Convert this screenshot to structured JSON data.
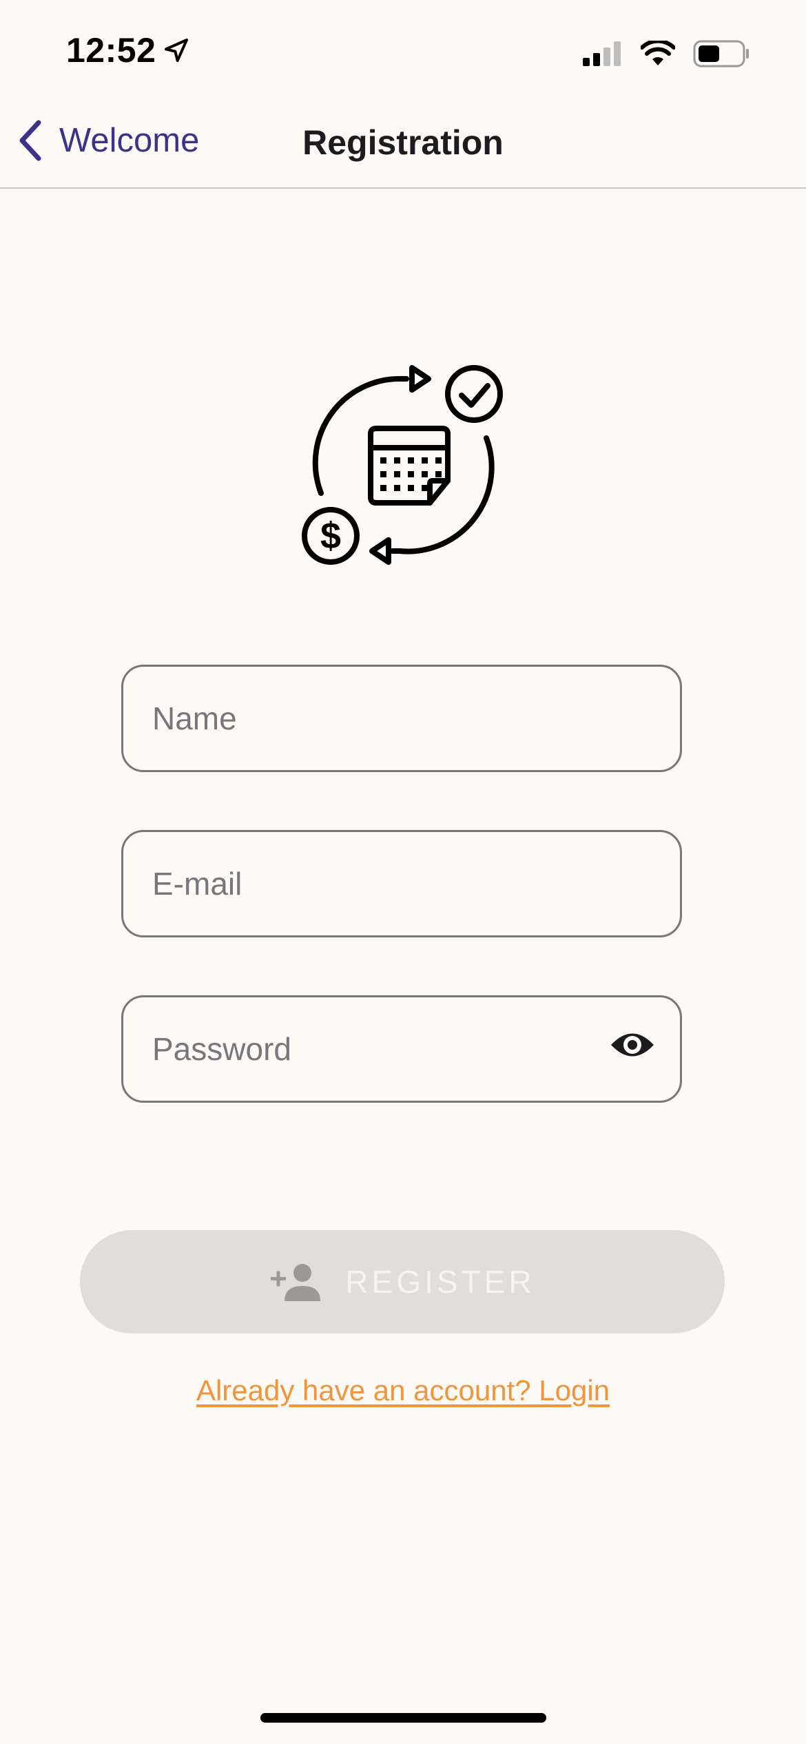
{
  "status_bar": {
    "time": "12:52",
    "location_icon": "location-arrow-icon",
    "signal_icon": "cellular-signal-icon",
    "wifi_icon": "wifi-icon",
    "battery_icon": "battery-icon"
  },
  "nav": {
    "back_label": "Welcome",
    "title": "Registration",
    "back_icon": "chevron-left-icon"
  },
  "hero": {
    "icon": "recurring-payment-calendar-icon"
  },
  "form": {
    "name_placeholder": "Name",
    "email_placeholder": "E-mail",
    "password_placeholder": "Password",
    "password_toggle_icon": "eye-icon"
  },
  "register_button": {
    "label": "REGISTER",
    "icon": "add-person-icon"
  },
  "login_link": {
    "label": "Already have an account? Login"
  },
  "colors": {
    "background": "#fcf9f6",
    "accent": "#3a3387",
    "link": "#f0953a",
    "button_disabled": "#e0dedb",
    "border": "#77767b"
  }
}
